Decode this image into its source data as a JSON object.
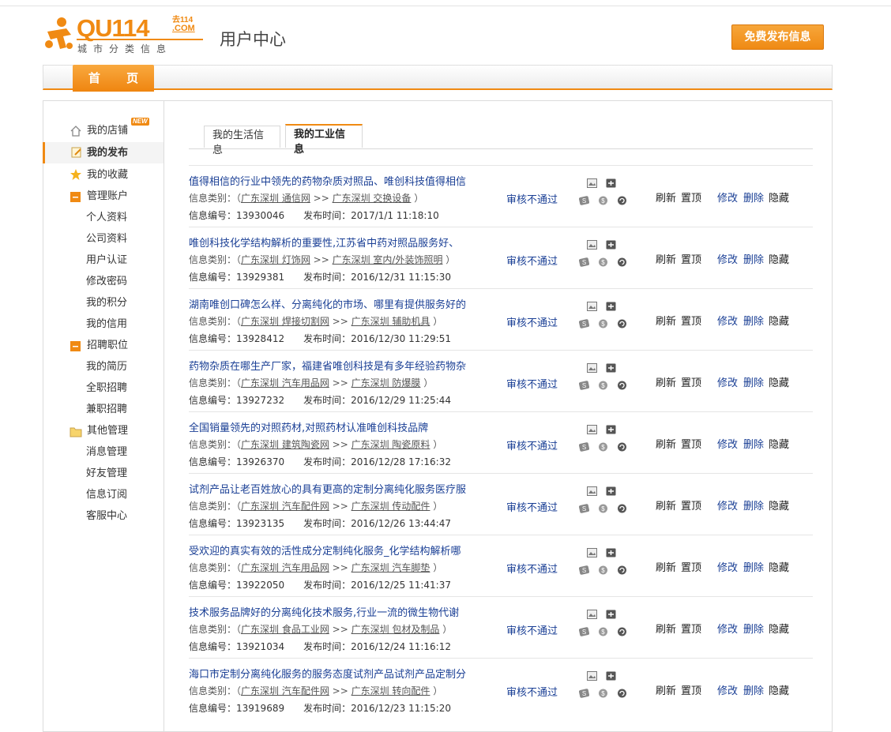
{
  "header": {
    "logo_main": "QU114",
    "logo_top": "去114",
    "logo_com": ".COM",
    "logo_sub": "城市分类信息",
    "page_title": "用户中心",
    "publish_button": "免费发布信息"
  },
  "nav": {
    "home": "首 页"
  },
  "sidebar": {
    "new_badge": "NEW",
    "my_store": "我的店铺",
    "my_posts": "我的发布",
    "my_favorites": "我的收藏",
    "account_group": "管理账户",
    "account_items": [
      "个人资料",
      "公司资料",
      "用户认证",
      "修改密码",
      "我的积分",
      "我的信用"
    ],
    "jobs_group": "招聘职位",
    "jobs_items": [
      "我的简历",
      "全职招聘",
      "兼职招聘"
    ],
    "other_group": "其他管理",
    "other_items": [
      "消息管理",
      "好友管理",
      "信息订阅",
      "客服中心"
    ]
  },
  "tabs": [
    "我的生活信息",
    "我的工业信息"
  ],
  "labels": {
    "category": "信息类别：（",
    "category_end": "）",
    "sep": ">>",
    "id": "信息编号：",
    "time": "发布时间：",
    "status": "审核不通过",
    "refresh": "刷新",
    "top": "置顶",
    "edit": "修改",
    "delete": "删除",
    "hide": "隐藏"
  },
  "posts": [
    {
      "title": "值得相信的行业中领先的药物杂质对照品、唯创科技值得相信",
      "cat1": "广东深圳 通信网",
      "cat2": "广东深圳 交换设备",
      "id": "13930046",
      "time": "2017/1/1 11:18:10"
    },
    {
      "title": "唯创科技化学结构解析的重要性,江苏省中药对照品服务好、",
      "cat1": "广东深圳 灯饰网",
      "cat2": "广东深圳 室内/外装饰照明",
      "id": "13929381",
      "time": "2016/12/31 11:15:30"
    },
    {
      "title": "湖南唯创口碑怎么样、分离纯化的市场、哪里有提供服务好的",
      "cat1": "广东深圳 焊接切割网",
      "cat2": "广东深圳 辅助机具",
      "id": "13928412",
      "time": "2016/12/30 11:29:51"
    },
    {
      "title": "药物杂质在哪生产厂家，福建省唯创科技是有多年经验药物杂",
      "cat1": "广东深圳 汽车用品网",
      "cat2": "广东深圳 防爆膜",
      "id": "13927232",
      "time": "2016/12/29 11:25:44"
    },
    {
      "title": "全国销量领先的对照药材,对照药材认准唯创科技品牌",
      "cat1": "广东深圳 建筑陶瓷网",
      "cat2": "广东深圳 陶瓷原料",
      "id": "13926370",
      "time": "2016/12/28 17:16:32"
    },
    {
      "title": "试剂产品让老百姓放心的具有更高的定制分离纯化服务医疗服",
      "cat1": "广东深圳 汽车配件网",
      "cat2": "广东深圳 传动配件",
      "id": "13923135",
      "time": "2016/12/26 13:44:47"
    },
    {
      "title": "受欢迎的真实有效的活性成分定制纯化服务_化学结构解析哪",
      "cat1": "广东深圳 汽车用品网",
      "cat2": "广东深圳 汽车脚垫",
      "id": "13922050",
      "time": "2016/12/25 11:41:37"
    },
    {
      "title": "技术服务品牌好的分离纯化技术服务,行业一流的微生物代谢",
      "cat1": "广东深圳 食品工业网",
      "cat2": "广东深圳 包材及制品",
      "id": "13921034",
      "time": "2016/12/24 11:16:12"
    },
    {
      "title": "海口市定制分离纯化服务的服务态度试剂产品试剂产品定制分",
      "cat1": "广东深圳 汽车配件网",
      "cat2": "广东深圳 转向配件",
      "id": "13919689",
      "time": "2016/12/23 11:15:20"
    }
  ],
  "colors": {
    "accent": "#f08a13",
    "link": "#1a3f95"
  }
}
